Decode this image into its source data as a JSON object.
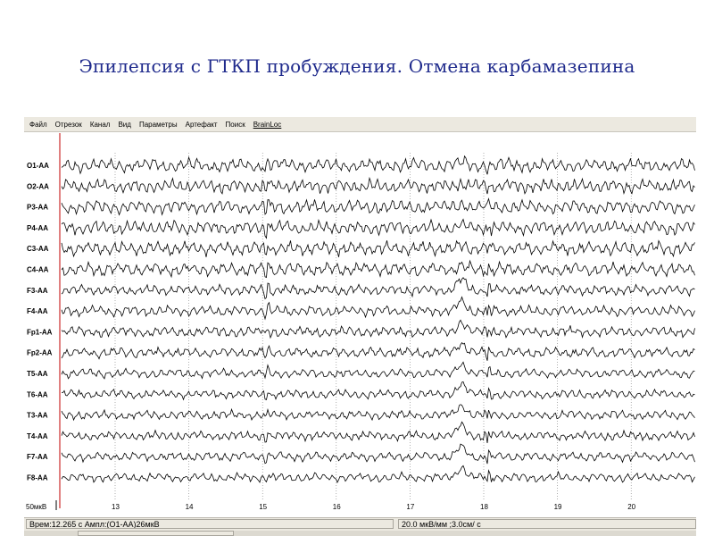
{
  "slide": {
    "title": "Эпилепсия с ГТКП пробуждения. Отмена карбамазепина"
  },
  "menu": [
    "Файл",
    "Отрезок",
    "Канал",
    "Вид",
    "Параметры",
    "Артефакт",
    "Поиск",
    "BrainLoc"
  ],
  "channels": [
    "O1-AA",
    "O2-AA",
    "P3-AA",
    "P4-AA",
    "C3-AA",
    "C4-AA",
    "F3-AA",
    "F4-AA",
    "Fp1-AA",
    "Fp2-AA",
    "T5-AA",
    "T6-AA",
    "T3-AA",
    "T4-AA",
    "F7-AA",
    "F8-AA"
  ],
  "time_ticks": [
    "13",
    "14",
    "15",
    "16",
    "17",
    "18",
    "19",
    "20"
  ],
  "calibration_label": "50мкВ",
  "status": {
    "left": "Врем:12.265 с Ампл:(O1-AA)26мкВ",
    "right": "20.0 мкВ/мм ;3.0см/ с"
  },
  "colors": {
    "title": "#1f2a8c",
    "trace": "#000000",
    "cursor": "#c00000",
    "grid": "#7a7a7a"
  }
}
